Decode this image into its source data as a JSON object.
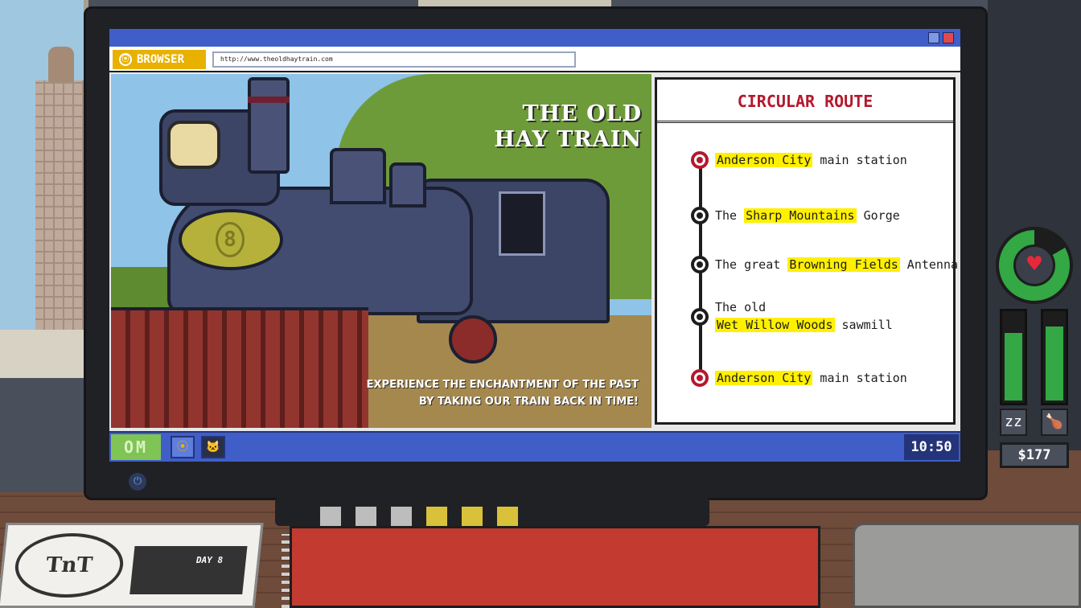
{
  "colors": {
    "os_blue": "#3f5ec8",
    "brand_yellow": "#e8b100",
    "route_red": "#b4182d",
    "highlight_yellow": "#fff000",
    "health_green": "#33a844",
    "heart_red": "#e7283a"
  },
  "browser": {
    "brand_label": "BROWSER",
    "brand_icon": "browser-logo-icon",
    "url": "http://www.theoldhaytrain.com"
  },
  "hero": {
    "title_line1": "THE OLD",
    "title_line2": "HAY TRAIN",
    "front_plate_number": "8",
    "tagline_line1": "EXPERIENCE THE ENCHANTMENT OF THE PAST",
    "tagline_line2": "BY TAKING OUR TRAIN BACK IN TIME!"
  },
  "route": {
    "title": "CIRCULAR ROUTE",
    "stops": [
      {
        "pre": "",
        "highlight": "Anderson City",
        "post": " main station",
        "terminal": true
      },
      {
        "pre": "The ",
        "highlight": "Sharp Mountains",
        "post": " Gorge",
        "terminal": false
      },
      {
        "pre": "The great ",
        "highlight": "Browning Fields",
        "post": " Antenna",
        "terminal": false
      },
      {
        "pre": "The old",
        "highlight": "Wet Willow Woods",
        "post": " sawmill",
        "terminal": false
      },
      {
        "pre": "",
        "highlight": "Anderson City",
        "post": " main station",
        "terminal": true
      }
    ]
  },
  "taskbar": {
    "os_label": "OM",
    "browser_icon": "browser-app-icon",
    "cat_icon": "cat-app-icon",
    "clock": "10:50"
  },
  "hud": {
    "health_icon": "heart-icon",
    "sleep_level": 0.78,
    "food_level": 0.85,
    "sleep_icon": "zz-sleep-icon",
    "food_icon": "drumstick-icon",
    "money": "$177"
  },
  "desk": {
    "newspaper_logo": "TnT",
    "newspaper_day": "DAY 8"
  }
}
